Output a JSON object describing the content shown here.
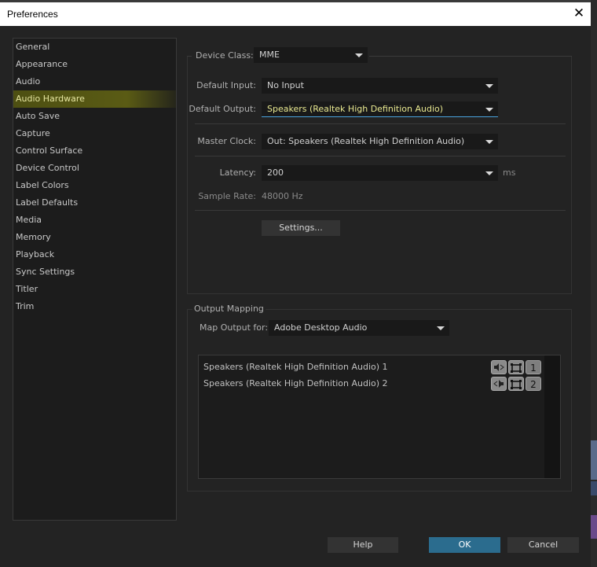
{
  "window": {
    "title": "Preferences",
    "close_glyph": "✕"
  },
  "sidebar": {
    "items": [
      {
        "label": "General"
      },
      {
        "label": "Appearance"
      },
      {
        "label": "Audio"
      },
      {
        "label": "Audio Hardware",
        "selected": true
      },
      {
        "label": "Auto Save"
      },
      {
        "label": "Capture"
      },
      {
        "label": "Control Surface"
      },
      {
        "label": "Device Control"
      },
      {
        "label": "Label Colors"
      },
      {
        "label": "Label Defaults"
      },
      {
        "label": "Media"
      },
      {
        "label": "Memory"
      },
      {
        "label": "Playback"
      },
      {
        "label": "Sync Settings"
      },
      {
        "label": "Titler"
      },
      {
        "label": "Trim"
      }
    ]
  },
  "hardware": {
    "device_class_label": "Device Class:",
    "device_class_value": "MME",
    "default_input_label": "Default Input:",
    "default_input_value": "No Input",
    "default_output_label": "Default Output:",
    "default_output_value": "Speakers (Realtek High Definition Audio)",
    "master_clock_label": "Master Clock:",
    "master_clock_value": "Out: Speakers (Realtek High Definition Audio)",
    "latency_label": "Latency:",
    "latency_value": "200",
    "latency_unit": "ms",
    "sample_rate_label": "Sample Rate:",
    "sample_rate_value": "48000 Hz",
    "settings_button": "Settings..."
  },
  "output_mapping": {
    "title": "Output Mapping",
    "map_output_label": "Map Output for:",
    "map_output_value": "Adobe Desktop Audio",
    "channels": [
      {
        "label": "Speakers (Realtek High Definition Audio) 1",
        "number": "1"
      },
      {
        "label": "Speakers (Realtek High Definition Audio) 2",
        "number": "2"
      }
    ]
  },
  "footer": {
    "help": "Help",
    "ok": "OK",
    "cancel": "Cancel"
  },
  "colors": {
    "accent": "#2b6c8e",
    "highlight": "#5a5b14",
    "focus_underline": "#4aa3df"
  }
}
